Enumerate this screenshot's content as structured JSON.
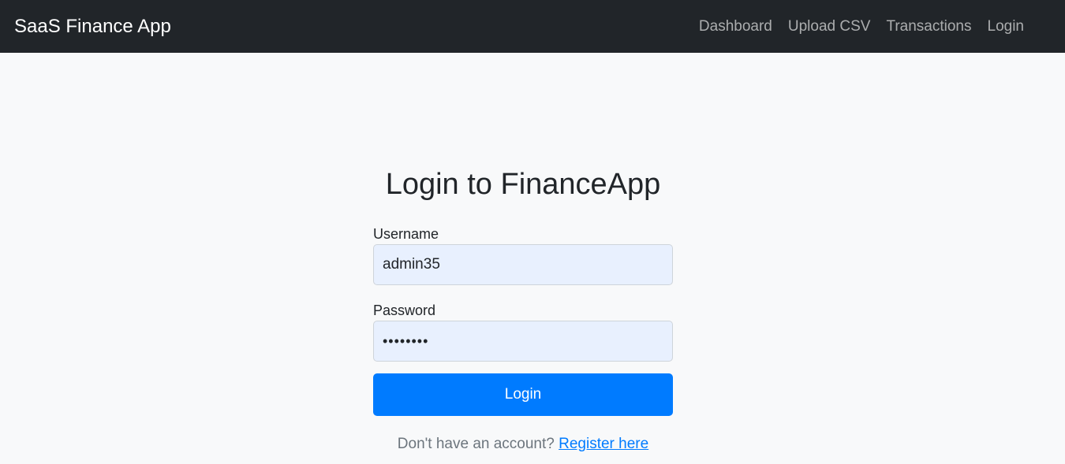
{
  "navbar": {
    "brand": "SaaS Finance App",
    "links": [
      {
        "label": "Dashboard"
      },
      {
        "label": "Upload CSV"
      },
      {
        "label": "Transactions"
      },
      {
        "label": "Login"
      }
    ],
    "background_color": "#212529"
  },
  "login": {
    "title": "Login to FinanceApp",
    "username": {
      "label": "Username",
      "value": "admin35"
    },
    "password": {
      "label": "Password",
      "value": "password"
    },
    "submit_label": "Login",
    "register_prompt": "Don't have an account?",
    "register_link": "Register here"
  },
  "colors": {
    "page_background": "#f8f9fa",
    "primary": "#007bff",
    "input_autofill_background": "#e8f0fe"
  }
}
